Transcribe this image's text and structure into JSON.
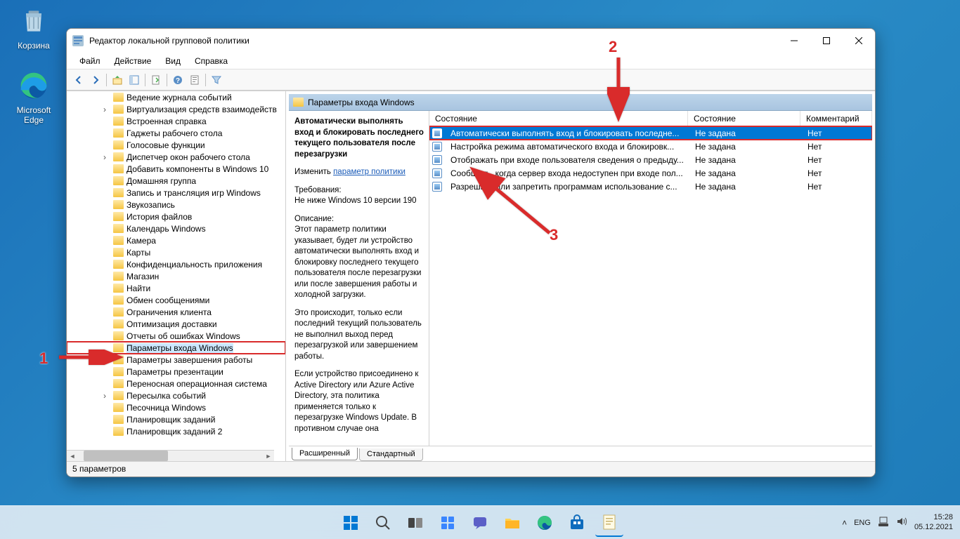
{
  "desktop": {
    "recycle": "Корзина",
    "edge": "Microsoft Edge"
  },
  "window": {
    "title": "Редактор локальной групповой политики",
    "menus": [
      "Файл",
      "Действие",
      "Вид",
      "Справка"
    ],
    "tree": [
      {
        "label": "Ведение журнала событий",
        "exp": false
      },
      {
        "label": "Виртуализация средств взаимодейств",
        "exp": true
      },
      {
        "label": "Встроенная справка",
        "exp": false
      },
      {
        "label": "Гаджеты рабочего стола",
        "exp": false
      },
      {
        "label": "Голосовые функции",
        "exp": false
      },
      {
        "label": "Диспетчер окон рабочего стола",
        "exp": true
      },
      {
        "label": "Добавить компоненты в Windows 10",
        "exp": false
      },
      {
        "label": "Домашняя группа",
        "exp": false
      },
      {
        "label": "Запись и трансляция игр Windows",
        "exp": false
      },
      {
        "label": "Звукозапись",
        "exp": false
      },
      {
        "label": "История файлов",
        "exp": false
      },
      {
        "label": "Календарь Windows",
        "exp": false
      },
      {
        "label": "Камера",
        "exp": false
      },
      {
        "label": "Карты",
        "exp": false
      },
      {
        "label": "Конфиденциальность приложения",
        "exp": false
      },
      {
        "label": "Магазин",
        "exp": false
      },
      {
        "label": "Найти",
        "exp": false
      },
      {
        "label": "Обмен сообщениями",
        "exp": false
      },
      {
        "label": "Ограничения клиента",
        "exp": false
      },
      {
        "label": "Оптимизация доставки",
        "exp": false
      },
      {
        "label": "Отчеты об ошибках Windows",
        "exp": false
      },
      {
        "label": "Параметры входа Windows",
        "exp": false,
        "selected": true
      },
      {
        "label": "Параметры завершения работы",
        "exp": false
      },
      {
        "label": "Параметры презентации",
        "exp": false
      },
      {
        "label": "Переносная операционная система",
        "exp": false
      },
      {
        "label": "Пересылка событий",
        "exp": true
      },
      {
        "label": "Песочница Windows",
        "exp": false
      },
      {
        "label": "Планировщик заданий",
        "exp": false
      },
      {
        "label": "Планировщик заданий 2",
        "exp": false
      }
    ],
    "header": "Параметры входа Windows",
    "detail": {
      "title": "Автоматически выполнять вход и блокировать последнего текущего пользователя после перезагрузки",
      "edit_prefix": "Изменить ",
      "edit_link": "параметр политики",
      "req_label": "Требования:",
      "req_text": "Не ниже Windows 10 версии 190",
      "desc_label": "Описание:",
      "desc_p1": "Этот параметр политики указывает, будет ли устройство автоматически выполнять вход и блокировку последнего текущего пользователя после перезагрузки или после завершения работы и холодной загрузки.",
      "desc_p2": "Это происходит, только если последний текущий пользователь не выполнил выход перед перезагрузкой или завершением работы.",
      "desc_p3": "Если устройство присоединено к Active Directory или Azure Active Directory, эта политика применяется только к перезагрузке Windows Update. В противном случае она"
    },
    "list": {
      "columns": [
        "Состояние",
        "Состояние",
        "Комментарий"
      ],
      "rows": [
        {
          "name": "Автоматически выполнять вход и блокировать последне...",
          "state": "Не задана",
          "comment": "Нет",
          "selected": true
        },
        {
          "name": "Настройка режима автоматического входа и блокировк...",
          "state": "Не задана",
          "comment": "Нет"
        },
        {
          "name": "Отображать при входе пользователя сведения о предыду...",
          "state": "Не задана",
          "comment": "Нет"
        },
        {
          "name": "Сообщать, когда сервер входа недоступен при входе пол...",
          "state": "Не задана",
          "comment": "Нет"
        },
        {
          "name": "Разрешить или запретить программам использование с...",
          "state": "Не задана",
          "comment": "Нет"
        }
      ]
    },
    "tabs": [
      "Расширенный",
      "Стандартный"
    ],
    "status": "5 параметров"
  },
  "annotations": {
    "n1": "1",
    "n2": "2",
    "n3": "3"
  },
  "taskbar": {
    "lang": "ENG",
    "time": "15:28",
    "date": "05.12.2021"
  }
}
